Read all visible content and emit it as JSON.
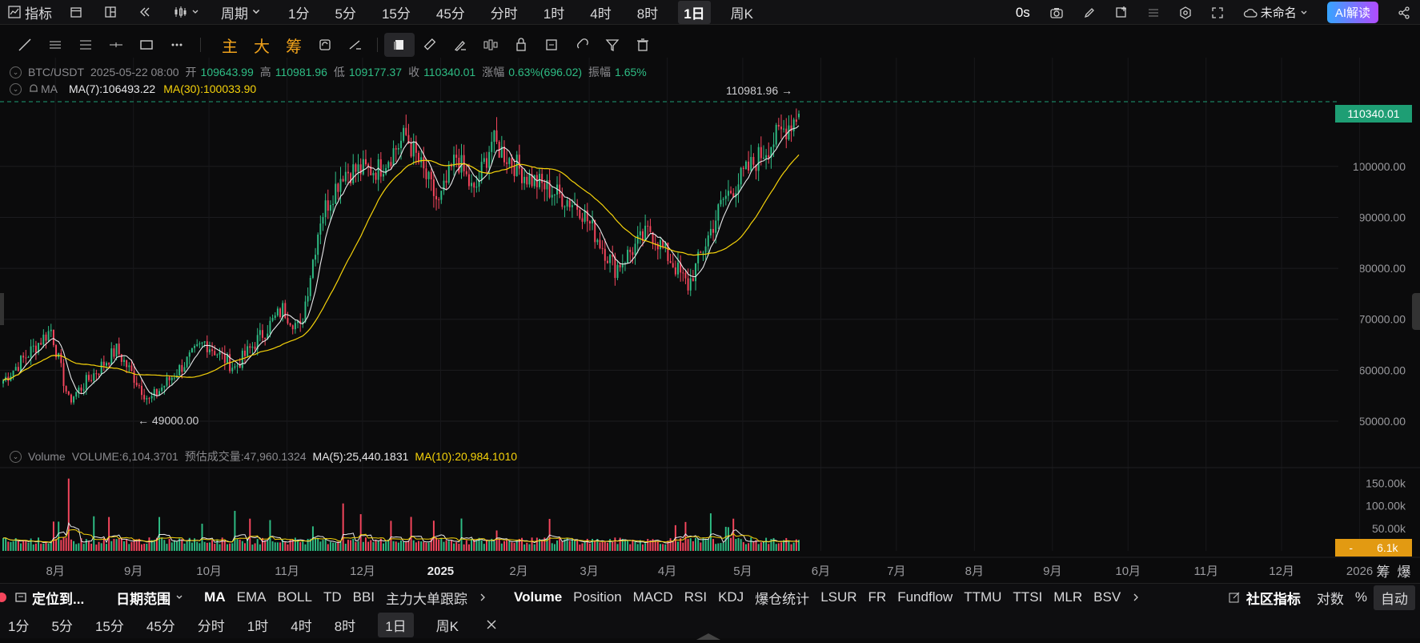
{
  "topbar": {
    "indicators_label": "指标",
    "period_label": "周期",
    "intervals": [
      "1分",
      "5分",
      "15分",
      "45分",
      "分时",
      "1时",
      "4时",
      "8时",
      "1日",
      "周K"
    ],
    "active_interval": "1日",
    "timer": "0s",
    "layout_name": "未命名",
    "ai_label": "AI解读"
  },
  "toolbar": {
    "main_label": "主",
    "big_label": "大",
    "chip_label": "筹"
  },
  "legend": {
    "pair": "BTC/USDT",
    "datetime": "2025-05-22 08:00",
    "open_label": "开",
    "open": "109643.99",
    "high_label": "高",
    "high": "110981.96",
    "low_label": "低",
    "low": "109177.37",
    "close_label": "收",
    "close": "110340.01",
    "change_label": "涨幅",
    "change": "0.63%(696.02)",
    "amplitude_label": "振幅",
    "amplitude": "1.65%",
    "ma_label": "MA",
    "ma7": "MA(7):106493.22",
    "ma30": "MA(30):100033.90"
  },
  "volume_legend": {
    "label": "Volume",
    "volume": "VOLUME:6,104.3701",
    "estimate": "预估成交量:47,960.1324",
    "ma5": "MA(5):25,440.1831",
    "ma10": "MA(10):20,984.1010"
  },
  "price_axis": {
    "ticks": [
      "100000.00",
      "90000.00",
      "80000.00",
      "70000.00",
      "60000.00",
      "50000.00"
    ],
    "current_price": "110340.01",
    "high_marker": "110981.96 →",
    "low_marker": "← 49000.00"
  },
  "volume_axis": {
    "ticks": [
      "150.00k",
      "100.00k",
      "50.00k"
    ],
    "current": "6.1k"
  },
  "time_axis": {
    "labels": [
      "8月",
      "9月",
      "10月",
      "11月",
      "12月",
      "2025",
      "2月",
      "3月",
      "4月",
      "5月",
      "6月",
      "7月",
      "8月",
      "9月",
      "10月",
      "11月",
      "12月",
      "2026"
    ],
    "right_labels": [
      "筹",
      "爆"
    ]
  },
  "colors": {
    "up": "#2ebd85",
    "down": "#f6465d",
    "ma_fast": "#e8e8ea",
    "ma_slow": "#f5d20a",
    "price_tag": "#1e9e74",
    "volume_tag": "#e29a12"
  },
  "chart_data": {
    "type": "candlestick",
    "symbol": "BTC/USDT",
    "interval": "1日",
    "ylim": [
      45000,
      115000
    ],
    "series": [
      {
        "name": "MA(7)",
        "last": 106493.22
      },
      {
        "name": "MA(30)",
        "last": 100033.9
      }
    ],
    "anchors": [
      {
        "date": "2024-07-10",
        "close": 58000
      },
      {
        "date": "2024-07-29",
        "close": 68000
      },
      {
        "date": "2024-08-05",
        "close": 54000
      },
      {
        "date": "2024-08-24",
        "close": 64000
      },
      {
        "date": "2024-09-06",
        "close": 54000
      },
      {
        "date": "2024-09-28",
        "close": 65500
      },
      {
        "date": "2024-10-10",
        "close": 60500
      },
      {
        "date": "2024-10-29",
        "close": 72000
      },
      {
        "date": "2024-11-05",
        "close": 68000
      },
      {
        "date": "2024-11-13",
        "close": 90000
      },
      {
        "date": "2024-11-22",
        "close": 99000
      },
      {
        "date": "2024-12-06",
        "close": 99500
      },
      {
        "date": "2024-12-17",
        "close": 106000
      },
      {
        "date": "2024-12-30",
        "close": 92500
      },
      {
        "date": "2025-01-06",
        "close": 102000
      },
      {
        "date": "2025-01-13",
        "close": 94500
      },
      {
        "date": "2025-01-20",
        "close": 105000
      },
      {
        "date": "2025-02-03",
        "close": 98000
      },
      {
        "date": "2025-02-24",
        "close": 92000
      },
      {
        "date": "2025-03-10",
        "close": 80000
      },
      {
        "date": "2025-03-24",
        "close": 87500
      },
      {
        "date": "2025-04-08",
        "close": 76500
      },
      {
        "date": "2025-04-22",
        "close": 93500
      },
      {
        "date": "2025-05-08",
        "close": 103000
      },
      {
        "date": "2025-05-22",
        "close": 110340
      }
    ],
    "last_candle": {
      "open": 109643.99,
      "high": 110981.96,
      "low": 109177.37,
      "close": 110340.01
    },
    "period_high": 110981.96,
    "period_low": 49000.0,
    "volume": {
      "last": 6104.3701,
      "ma5": 25440.1831,
      "ma10": 20984.101,
      "ylim": [
        0,
        170000
      ]
    }
  },
  "bottom1": {
    "locate": "定位到...",
    "date_range": "日期范围",
    "main_indicators": [
      "MA",
      "EMA",
      "BOLL",
      "TD",
      "BBI",
      "主力大单跟踪"
    ],
    "sub_indicators": [
      "Volume",
      "Position",
      "MACD",
      "RSI",
      "KDJ",
      "爆仓统计",
      "LSUR",
      "FR",
      "Fundflow",
      "TTMU",
      "TTSI",
      "MLR",
      "BSV"
    ],
    "community": "社区指标",
    "log_label": "对数",
    "pct_label": "%",
    "auto_label": "自动"
  },
  "bottom2": {
    "intervals": [
      "1分",
      "5分",
      "15分",
      "45分",
      "分时",
      "1时",
      "4时",
      "8时",
      "1日",
      "周K"
    ],
    "active": "1日"
  }
}
